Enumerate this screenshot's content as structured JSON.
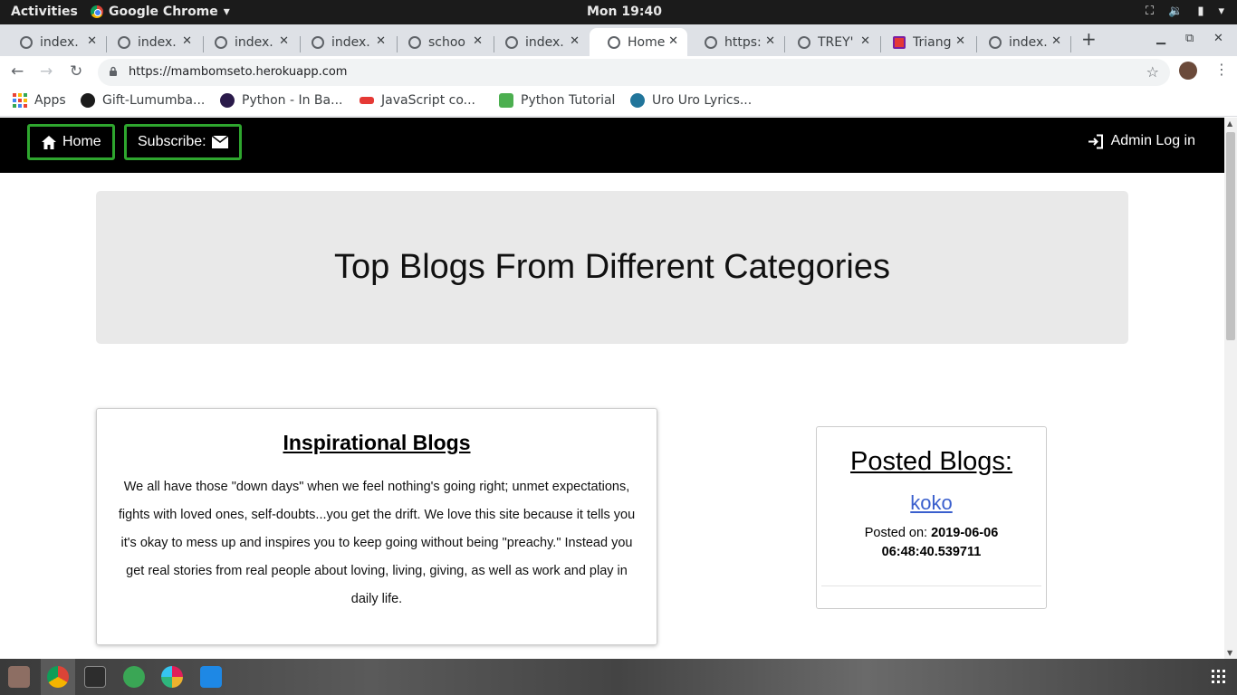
{
  "system": {
    "activities": "Activities",
    "app_menu": "Google Chrome",
    "clock": "Mon 19:40"
  },
  "tabs": [
    {
      "label": "index.",
      "active": false
    },
    {
      "label": "index.",
      "active": false
    },
    {
      "label": "index.",
      "active": false
    },
    {
      "label": "index.",
      "active": false
    },
    {
      "label": "schoo",
      "active": false
    },
    {
      "label": "index.",
      "active": false
    },
    {
      "label": "Home",
      "active": true
    },
    {
      "label": "https:",
      "active": false
    },
    {
      "label": "TREY'",
      "active": false
    },
    {
      "label": "Triang",
      "active": false
    },
    {
      "label": "index.",
      "active": false
    }
  ],
  "address_bar": {
    "url": "https://mambomseto.herokuapp.com"
  },
  "bookmarks": [
    {
      "label": "Apps",
      "icon": "apps-grid-icon"
    },
    {
      "label": "Gift-Lumumba...",
      "icon": "github-icon"
    },
    {
      "label": "Python - In Ba...",
      "icon": "podcast-icon"
    },
    {
      "label": "JavaScript co...",
      "icon": "javascript-site-icon"
    },
    {
      "label": "Python Tutorial",
      "icon": "w3schools-icon"
    },
    {
      "label": "Uro Uro Lyrics...",
      "icon": "wordpress-icon"
    }
  ],
  "site_nav": {
    "home": "Home",
    "subscribe": "Subscribe:",
    "admin": "Admin Log in"
  },
  "hero": {
    "title": "Top Blogs From Different Categories"
  },
  "category_card": {
    "title": "Inspirational Blogs",
    "body": "We all have those \"down days\" when we feel nothing's going right; unmet expectations, fights with loved ones, self-doubts...you get the drift. We love this site because it tells you it's okay to mess up and inspires you to keep going without being \"preachy.\" Instead you get real stories from real people about loving, living, giving, as well as work and play in daily life."
  },
  "posted_blogs": {
    "heading": "Posted Blogs:",
    "items": [
      {
        "title": "koko",
        "posted_label": "Posted on: ",
        "posted_date": "2019-06-06 06:48:40.539711"
      }
    ]
  },
  "colors": {
    "nav_border": "#2ea62e",
    "link": "#3a5fcd",
    "jumbotron_bg": "#e9e9e9"
  }
}
